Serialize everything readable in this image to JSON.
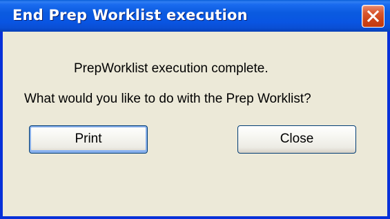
{
  "window": {
    "title": "End Prep Worklist execution"
  },
  "dialog": {
    "message_line1": "PrepWorklist execution complete.",
    "message_line2": "What would you like to do with the Prep Worklist?",
    "print_label": "Print",
    "close_label": "Close"
  },
  "colors": {
    "titlebar": "#0955e2",
    "dialog_background": "#ece9d8",
    "close_button": "#d9572e",
    "focus_ring": "#86aee9"
  },
  "icons": {
    "close": "close-icon"
  }
}
